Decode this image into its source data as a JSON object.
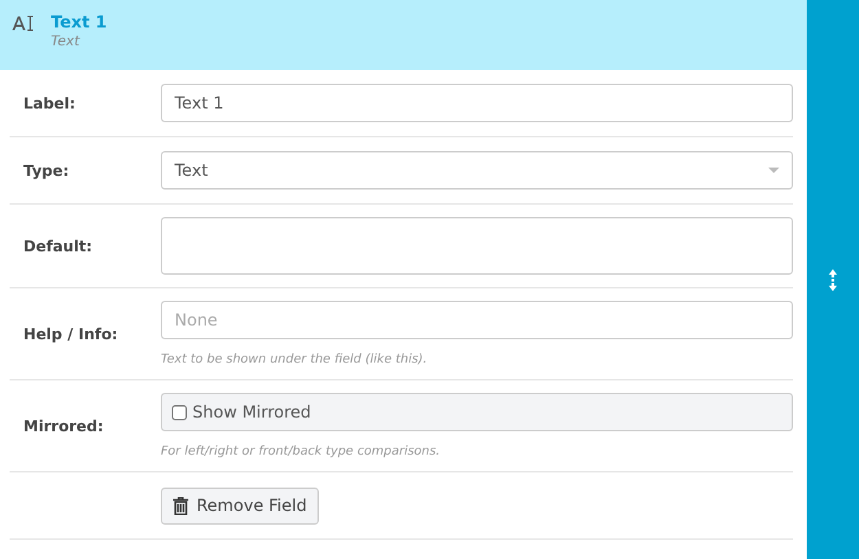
{
  "header": {
    "title": "Text 1",
    "subtitle": "Text"
  },
  "rows": [
    {
      "kind": "text",
      "label": "Label:",
      "value": "Text 1"
    },
    {
      "kind": "select",
      "label": "Type:",
      "value": "Text"
    },
    {
      "kind": "textarea",
      "label": "Default:"
    },
    {
      "kind": "text",
      "label": "Help / Info:",
      "placeholder": "None",
      "help": "Text to be shown under the field (like this)."
    },
    {
      "kind": "checkbox",
      "label": "Mirrored:",
      "text": "Show Mirrored",
      "checked": false,
      "help": "For left/right or front/back type comparisons."
    },
    {
      "kind": "button",
      "text": "Remove Field"
    }
  ]
}
